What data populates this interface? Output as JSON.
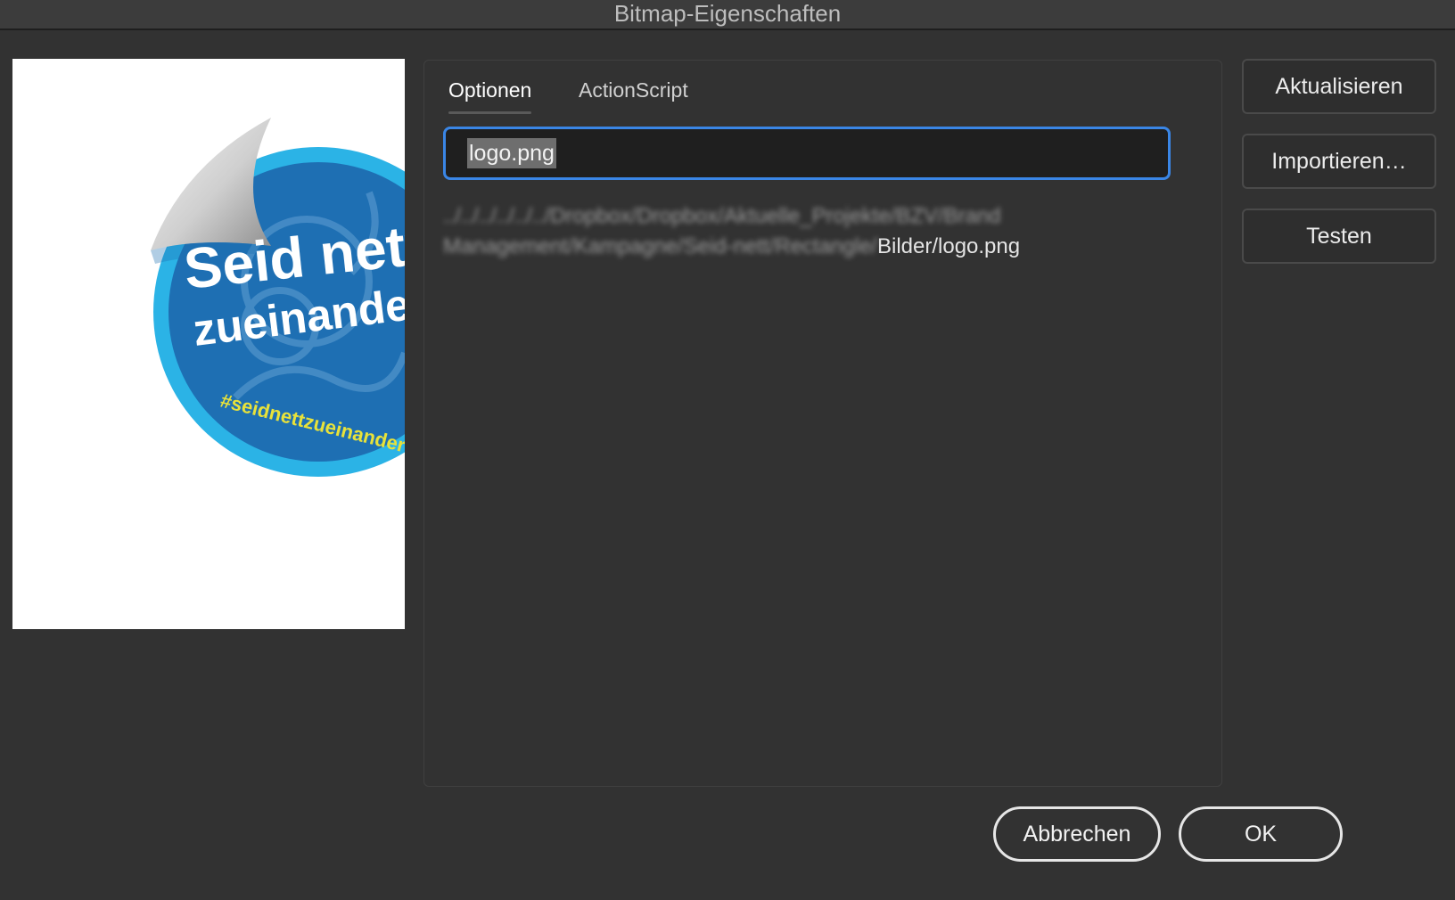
{
  "window": {
    "title": "Bitmap-Eigenschaften"
  },
  "tabs": [
    {
      "label": "Optionen",
      "active": true
    },
    {
      "label": "ActionScript",
      "active": false
    }
  ],
  "name_field": {
    "value": "logo.png",
    "selected": true
  },
  "path": {
    "blurred_part": "../../../../../../Dropbox/Dropbox/Aktuelle_Projekte/BZV/Brand Management/Kampagne/Seid-nett/Rectangle/",
    "visible_part": "Bilder/logo.png"
  },
  "side_buttons": {
    "update_label": "Aktualisieren",
    "import_label": "Importieren…",
    "test_label": "Testen"
  },
  "footer_buttons": {
    "cancel_label": "Abbrechen",
    "ok_label": "OK"
  },
  "preview": {
    "logo_text_line1": "Seid nett",
    "logo_text_line2": "zueinander",
    "logo_hashtag": "#seidnettzueinander",
    "colors": {
      "sticker_blue": "#1e6fb3",
      "sticker_rim": "#2bb3e6",
      "hashtag_yellow": "#e8e23a"
    }
  },
  "colors": {
    "accent": "#3a86e6",
    "background": "#323232"
  }
}
